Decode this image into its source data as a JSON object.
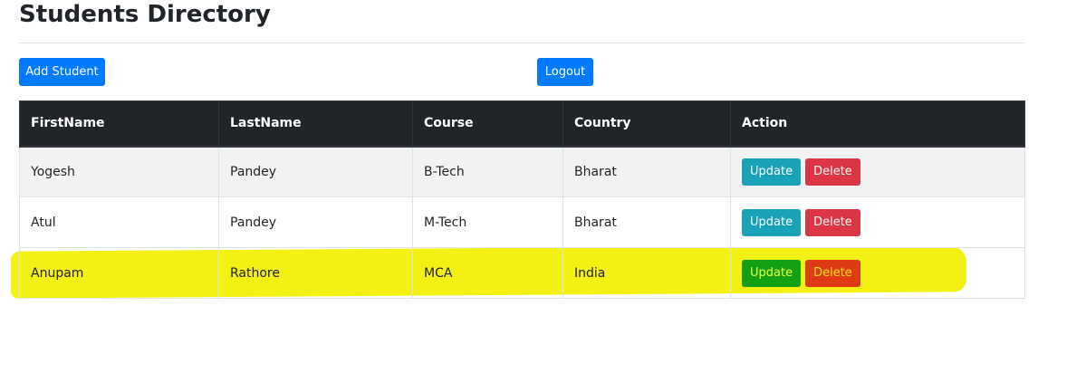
{
  "header": {
    "title": "Students Directory"
  },
  "toolbar": {
    "add_label": "Add Student",
    "logout_label": "Logout"
  },
  "table": {
    "columns": [
      "FirstName",
      "LastName",
      "Course",
      "Country",
      "Action"
    ],
    "rows": [
      {
        "first": "Yogesh",
        "last": "Pandey",
        "course": "B-Tech",
        "country": "Bharat"
      },
      {
        "first": "Atul",
        "last": "Pandey",
        "course": "M-Tech",
        "country": "Bharat"
      },
      {
        "first": "Anupam",
        "last": "Rathore",
        "course": "MCA",
        "country": "India"
      }
    ],
    "update_label": "Update",
    "delete_label": "Delete"
  },
  "colors": {
    "primary": "#007bff",
    "info": "#17a2b8",
    "danger": "#dc3545",
    "header_bg": "#212529",
    "highlight": "#f2f000"
  }
}
